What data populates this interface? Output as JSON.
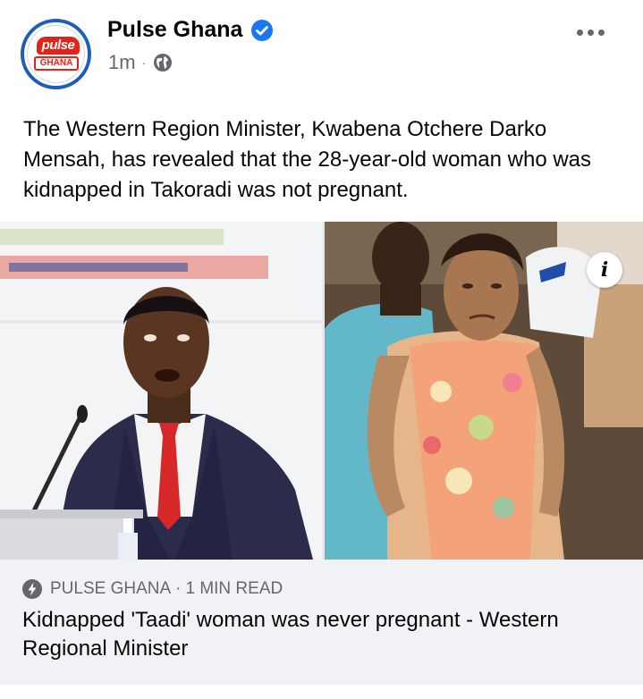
{
  "post": {
    "page_name": "Pulse Ghana",
    "timestamp": "1m",
    "separator": "·",
    "text": "The Western Region Minister, Kwabena Otchere Darko Mensah, has revealed that the 28-year-old woman who was kidnapped in Takoradi was not pregnant.",
    "logo": {
      "top": "pulse",
      "bottom": "GHANA"
    },
    "icons": {
      "verified": "verified-badge-icon",
      "audience": "globe-icon",
      "more": "more-options-icon",
      "info": "info-icon"
    }
  },
  "link_preview": {
    "source": "PULSE GHANA",
    "separator": "·",
    "read_time": "1 MIN READ",
    "title": "Kidnapped 'Taadi' woman was never pregnant - Western Regional Minister",
    "icon": "pulse-bolt-icon"
  },
  "colors": {
    "accent": "#1877f2",
    "brand_red": "#e2231a",
    "avatar_ring": "#1d5fb8",
    "secondary_text": "#65676b",
    "link_bg": "#f0f2f5"
  }
}
